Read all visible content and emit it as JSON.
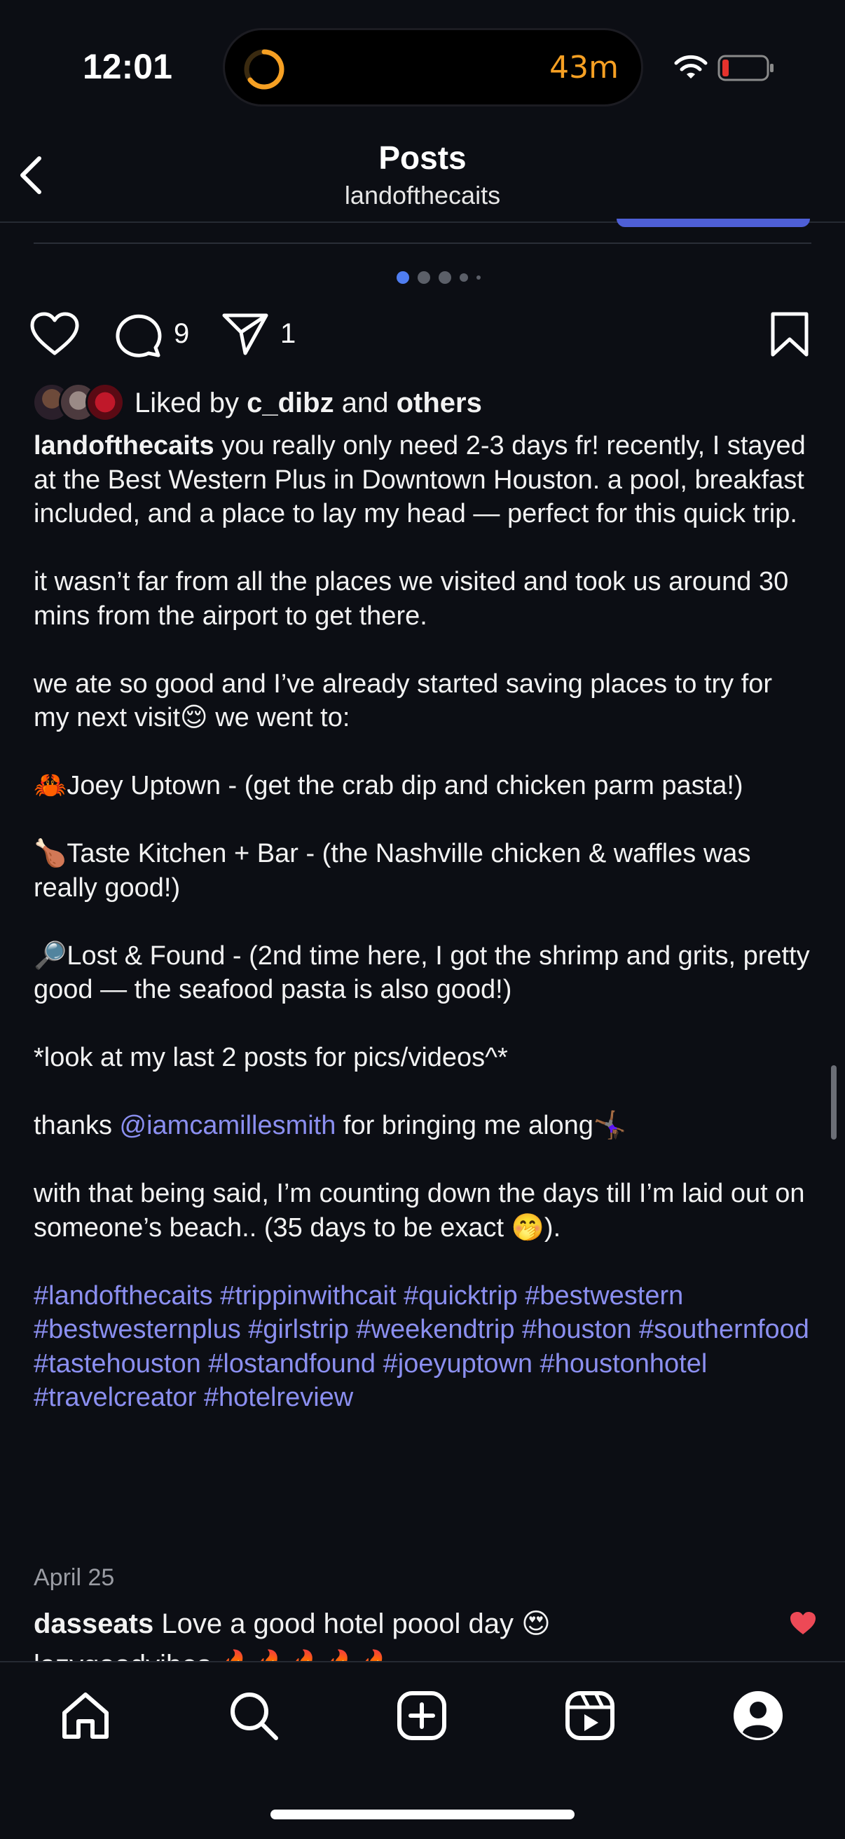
{
  "status_bar": {
    "time": "12:01",
    "timer": "43m"
  },
  "header": {
    "title": "Posts",
    "subtitle": "landofthecaits"
  },
  "actions": {
    "comment_count": "9",
    "share_count": "1"
  },
  "likes": {
    "prefix": "Liked by",
    "user": "c_dibz",
    "conjunction": "and",
    "others": "others"
  },
  "caption": {
    "username": "landofthecaits",
    "p1": " you really only need 2-3 days fr! recently, I stayed at the Best Western Plus in Downtown Houston. a pool, breakfast included, and a place to lay my head — perfect for this quick trip.",
    "p2": "it wasn’t far from all the places we visited and took us around 30 mins from the airport to get there.",
    "p3": "we ate so good and I’ve already started saving places to try for my next visit😌 we went to:",
    "p4": "🦀Joey Uptown - (get the crab dip and chicken parm pasta!)",
    "p5": "🍗Taste Kitchen + Bar - (the Nashville chicken & waffles was really good!)",
    "p6": "🔎Lost & Found - (2nd time here, I got the shrimp and grits, pretty good — the seafood pasta is also good!)",
    "p7": "*look at my last 2 posts for pics/videos^*",
    "p8_pre": "thanks ",
    "p8_mention": "@iamcamillesmith",
    "p8_post": " for bringing me along🤸🏾‍♀️",
    "p9": "with that being said, I’m counting down the days till I’m laid out on someone’s beach.. (35 days to be exact 🤭).",
    "hashtags": "#landofthecaits #trippinwithcait #quicktrip #bestwestern #bestwesternplus #girlstrip #weekendtrip #houston #southernfood #tastehouston #lostandfound #joeyuptown #houstonhotel #travelcreator #hotelreview"
  },
  "date": "April 25",
  "comment": {
    "user": "dasseats",
    "text": " Love a good hotel poool day 😍"
  },
  "comment_partial": "lazygoodvibes 🔥🔥🔥🔥🔥",
  "colors": {
    "accent": "#8b8ff0",
    "timer": "#f6a023",
    "like_red": "#ed4956",
    "blue_sliver": "#4e5fd6"
  },
  "icons": [
    "back-chevron-icon",
    "heart-icon",
    "comment-icon",
    "share-icon",
    "bookmark-icon",
    "home-icon",
    "search-icon",
    "create-icon",
    "reels-icon",
    "profile-icon",
    "wifi-icon",
    "battery-icon"
  ]
}
